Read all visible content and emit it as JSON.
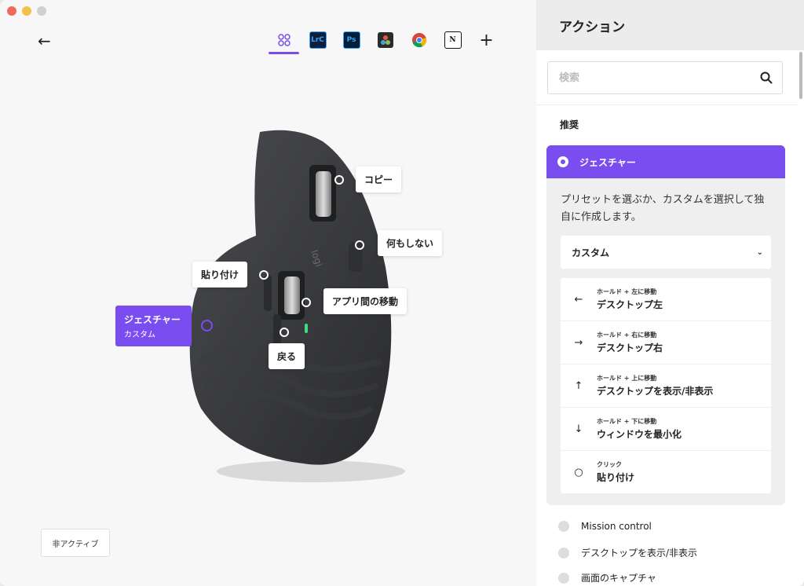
{
  "apps": [
    {
      "name": "all-apps",
      "label": ""
    },
    {
      "name": "lightroom",
      "label": "LrC"
    },
    {
      "name": "photoshop",
      "label": "Ps"
    },
    {
      "name": "davinci",
      "label": ""
    },
    {
      "name": "chrome",
      "label": ""
    },
    {
      "name": "notion",
      "label": "N"
    }
  ],
  "mouse": {
    "callouts": {
      "copy": "コピー",
      "nothing": "何もしない",
      "paste": "貼り付け",
      "app_switch": "アプリ間の移動",
      "back": "戻る"
    },
    "active": {
      "title": "ジェスチャー",
      "subtitle": "カスタム"
    }
  },
  "inactive_label": "非アクティブ",
  "panel": {
    "title": "アクション",
    "search_placeholder": "検索",
    "section": "推奨",
    "selected": {
      "title": "ジェスチャー",
      "description": "プリセットを選ぶか、カスタムを選択して独自に作成します。",
      "preset": "カスタム",
      "gestures": [
        {
          "icon": "←",
          "sub": "ホールド + 左に移動",
          "label": "デスクトップ左"
        },
        {
          "icon": "→",
          "sub": "ホールド + 右に移動",
          "label": "デスクトップ右"
        },
        {
          "icon": "↑",
          "sub": "ホールド + 上に移動",
          "label": "デスクトップを表示/非表示"
        },
        {
          "icon": "↓",
          "sub": "ホールド + 下に移動",
          "label": "ウィンドウを最小化"
        },
        {
          "icon": "○",
          "sub": "クリック",
          "label": "貼り付け"
        }
      ]
    },
    "options": [
      "Mission control",
      "デスクトップを表示/非表示",
      "画面のキャプチャ"
    ]
  },
  "colors": {
    "accent": "#7a4df0"
  }
}
